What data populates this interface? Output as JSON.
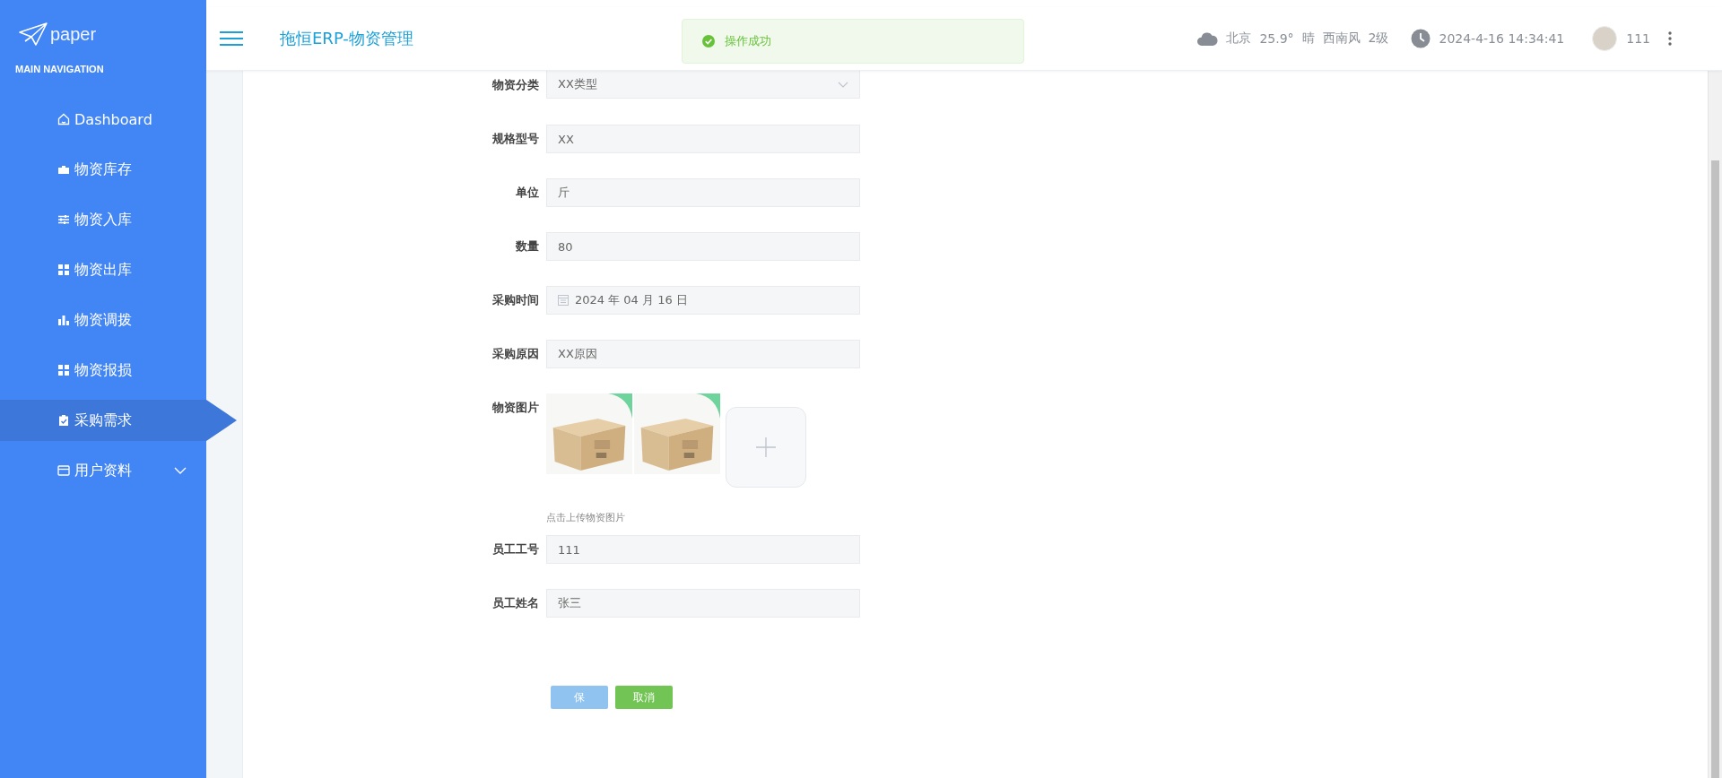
{
  "sidebar": {
    "logo": "paper",
    "section_title": "MAIN NAVIGATION",
    "items": [
      {
        "label": "Dashboard",
        "kind": "home",
        "selected": false
      },
      {
        "label": "物资库存",
        "kind": "briefcase",
        "selected": false
      },
      {
        "label": "物资入库",
        "kind": "sliders",
        "selected": false
      },
      {
        "label": "物资出库",
        "kind": "grid",
        "selected": false
      },
      {
        "label": "物资调拨",
        "kind": "bars",
        "selected": false
      },
      {
        "label": "物资报损",
        "kind": "grid",
        "selected": false
      },
      {
        "label": "采购需求",
        "kind": "clipboard",
        "selected": true
      },
      {
        "label": "用户资料",
        "kind": "card",
        "selected": false,
        "expandable": true
      }
    ]
  },
  "header": {
    "title": "拖恒ERP-物资管理",
    "weather": {
      "city": "北京",
      "temp": "25.9°",
      "condition": "晴",
      "wind": "西南风",
      "wind_level": "2级"
    },
    "datetime": "2024-4-16 14:34:41",
    "user": "111"
  },
  "toast": {
    "message": "操作成功"
  },
  "form": {
    "fields": [
      {
        "kind": "select",
        "label": "物资分类",
        "value": "XX类型"
      },
      {
        "kind": "text",
        "label": "规格型号",
        "value": "XX"
      },
      {
        "kind": "text",
        "label": "单位",
        "value": "斤"
      },
      {
        "kind": "text",
        "label": "数量",
        "value": "80"
      },
      {
        "kind": "date",
        "label": "采购时间",
        "value": "2024 年 04 月 16 日"
      },
      {
        "kind": "text",
        "label": "采购原因",
        "value": "XX原因"
      },
      {
        "kind": "upload",
        "label": "物资图片",
        "hint": "点击上传物资图片"
      },
      {
        "kind": "text",
        "label": "员工工号",
        "value": "111"
      },
      {
        "kind": "text",
        "label": "员工姓名",
        "value": "张三"
      }
    ],
    "buttons": [
      {
        "label": "保",
        "kind": "primary"
      },
      {
        "label": "取消",
        "kind": "success"
      }
    ]
  }
}
